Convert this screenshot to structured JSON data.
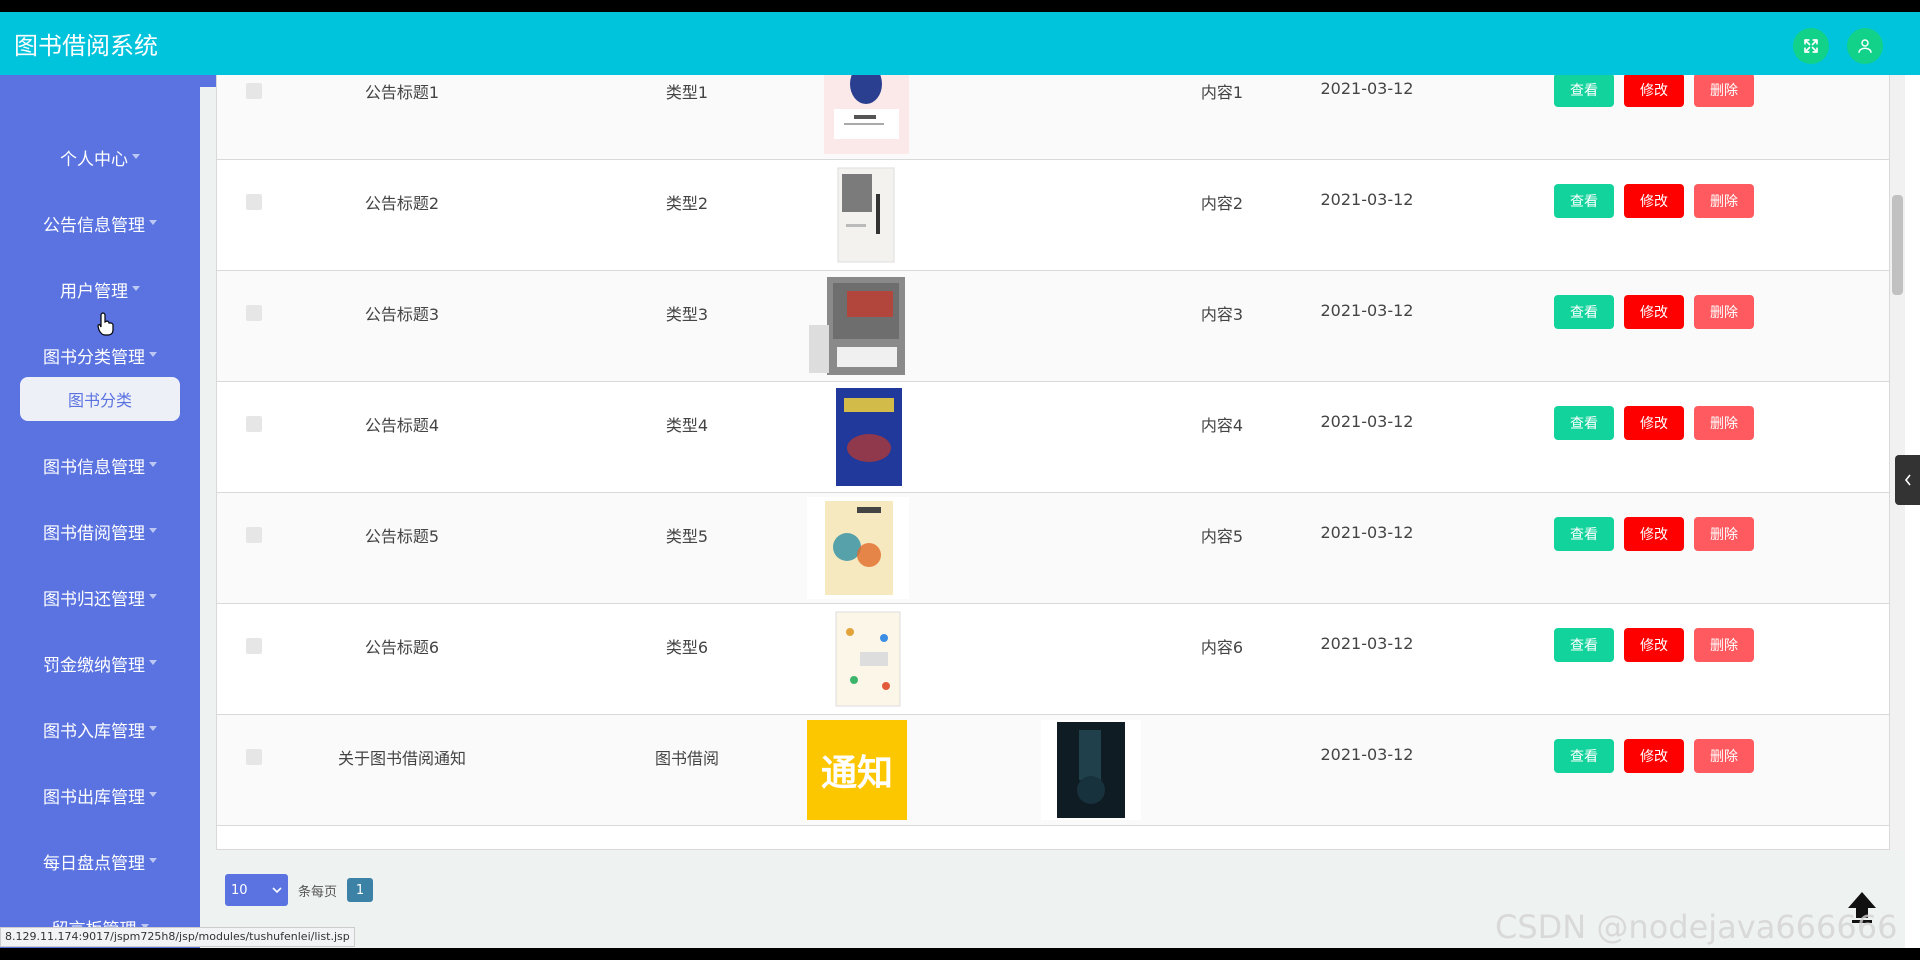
{
  "app": {
    "title": "图书借阅系统"
  },
  "sidebar": {
    "items": [
      {
        "label": "个人中心"
      },
      {
        "label": "公告信息管理"
      },
      {
        "label": "用户管理"
      },
      {
        "label": "图书分类管理"
      },
      {
        "label": "图书信息管理"
      },
      {
        "label": "图书借阅管理"
      },
      {
        "label": "图书归还管理"
      },
      {
        "label": "罚金缴纳管理"
      },
      {
        "label": "图书入库管理"
      },
      {
        "label": "图书出库管理"
      },
      {
        "label": "每日盘点管理"
      },
      {
        "label": "留言板管理"
      }
    ],
    "active_sub": "图书分类"
  },
  "buttons": {
    "view": "查看",
    "edit": "修改",
    "delete": "删除"
  },
  "rows": [
    {
      "title": "公告标题1",
      "type": "类型1",
      "content": "内容1",
      "date": "2021-03-12"
    },
    {
      "title": "公告标题2",
      "type": "类型2",
      "content": "内容2",
      "date": "2021-03-12"
    },
    {
      "title": "公告标题3",
      "type": "类型3",
      "content": "内容3",
      "date": "2021-03-12"
    },
    {
      "title": "公告标题4",
      "type": "类型4",
      "content": "内容4",
      "date": "2021-03-12"
    },
    {
      "title": "公告标题5",
      "type": "类型5",
      "content": "内容5",
      "date": "2021-03-12"
    },
    {
      "title": "公告标题6",
      "type": "类型6",
      "content": "内容6",
      "date": "2021-03-12"
    },
    {
      "title": "关于图书借阅通知",
      "type": "图书借阅",
      "content": "",
      "date": "2021-03-12",
      "cover_text": "通知"
    }
  ],
  "pagination": {
    "page_size": "10",
    "per_page_label": "条每页",
    "current_page": "1"
  },
  "status_url": "8.129.11.174:9017/jspm725h8/jsp/modules/tushufenlei/list.jsp",
  "watermark": "CSDN @nodejava666666",
  "colors": {
    "header": "#00c3dc",
    "sidebar": "#5a73e0",
    "view": "#12d39b",
    "edit": "#ff0000",
    "delete": "#ff5a5f"
  }
}
